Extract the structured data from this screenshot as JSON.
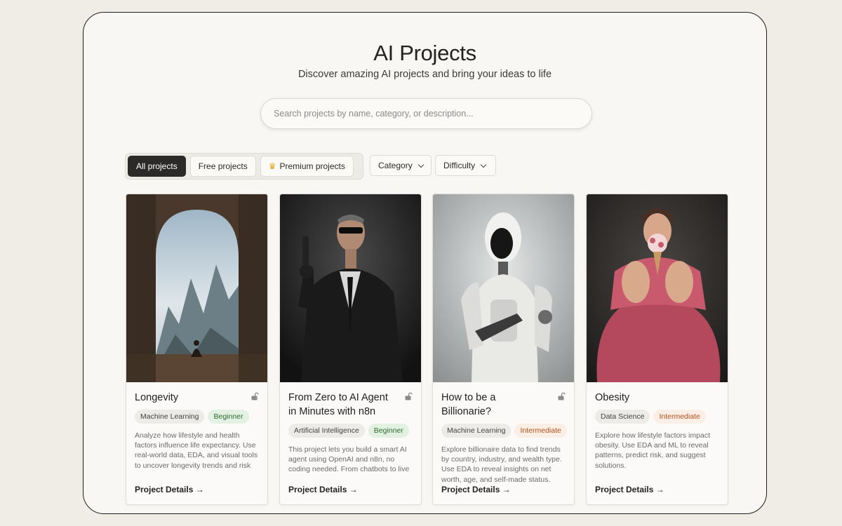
{
  "header": {
    "title": "AI Projects",
    "subtitle": "Discover amazing AI projects and bring your ideas to life"
  },
  "search": {
    "placeholder": "Search projects by name, category, or description...",
    "value": ""
  },
  "filters": {
    "tabs": [
      {
        "label": "All projects",
        "active": true
      },
      {
        "label": "Free projects",
        "active": false
      },
      {
        "label": "Premium projects",
        "active": false,
        "icon": "crown-icon"
      }
    ],
    "dropdowns": [
      {
        "label": "Category"
      },
      {
        "label": "Difficulty"
      }
    ]
  },
  "cards": [
    {
      "title": "Longevity",
      "image": "archway-mountain-meditation-image",
      "locked_icon": "unlock-icon",
      "category": "Machine Learning",
      "difficulty": "Beginner",
      "description": "Analyze how lifestyle and health factors influence life expectancy. Use real-world data, EDA, and visual tools to uncover longevity trends and risk factors.",
      "link": "Project Details →"
    },
    {
      "title": "From Zero to AI Agent in Minutes with n8n",
      "image": "agent-in-suit-with-gun-image",
      "locked_icon": "unlock-icon",
      "category": "Artificial Intelligence",
      "difficulty": "Beginner",
      "description": "This project lets you build a smart AI agent using OpenAI and n8n, no coding needed. From chatbots to live data automation, everything is",
      "link": "Project Details →"
    },
    {
      "title": "How to be a Billionarie?",
      "image": "white-robot-image",
      "locked_icon": "unlock-icon",
      "category": "Machine Learning",
      "difficulty": "Intermediate",
      "description": "Explore billionaire data to find trends by country, industry, and wealth type. Use EDA to reveal insights on net worth, age, and self-made status.",
      "link": "Project Details →"
    },
    {
      "title": "Obesity",
      "image": "woman-pink-dress-ice-cream-image",
      "locked_icon": "unlock-icon",
      "category": "Data Science",
      "difficulty": "Intermediate",
      "description": "Explore how lifestyle factors impact obesity. Use EDA and ML to reveal patterns, predict risk, and suggest solutions.",
      "link": "Project Details →"
    }
  ]
}
